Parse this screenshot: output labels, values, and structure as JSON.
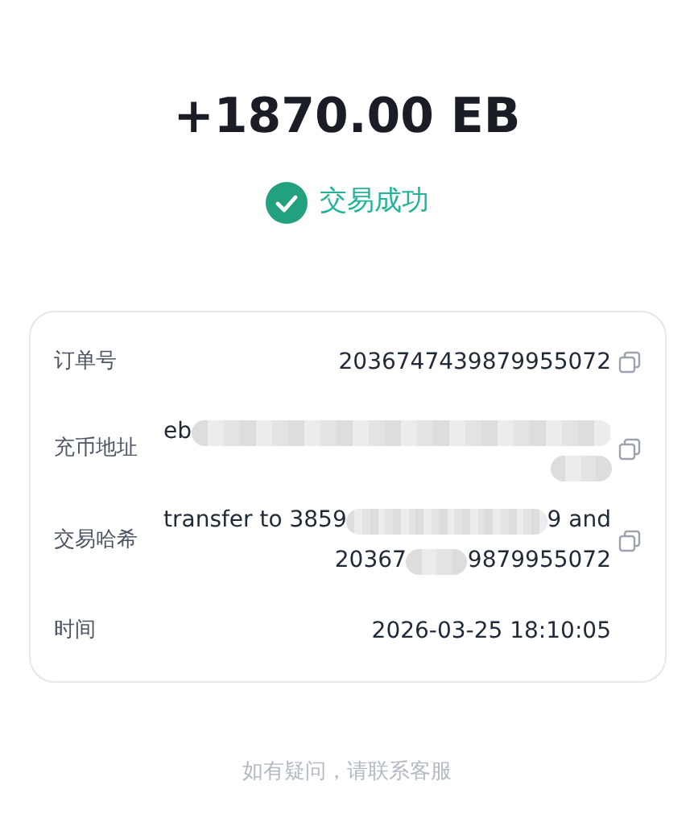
{
  "amount": "+1870.00 EB",
  "status": {
    "text": "交易成功",
    "success": true
  },
  "details": [
    {
      "label": "订单号",
      "lines": [
        [
          {
            "kind": "text",
            "text": "2036747439879955072"
          }
        ]
      ],
      "copyable": true
    },
    {
      "label": "充币地址",
      "lines": [
        [
          {
            "kind": "text",
            "text": "eb"
          },
          {
            "kind": "blur"
          }
        ],
        [
          {
            "kind": "blur"
          }
        ]
      ],
      "copyable": true
    },
    {
      "label": "交易哈希",
      "lines": [
        [
          {
            "kind": "text",
            "text": "transfer to 3859"
          },
          {
            "kind": "blur"
          },
          {
            "kind": "text",
            "text": "9 and"
          }
        ],
        [
          {
            "kind": "text",
            "text": "20367"
          },
          {
            "kind": "blur"
          },
          {
            "kind": "text",
            "text": "9879955072"
          }
        ]
      ],
      "copyable": true
    },
    {
      "label": "时间",
      "lines": [
        [
          {
            "kind": "text",
            "text": "2026-03-25 18:10:05"
          }
        ]
      ],
      "copyable": false
    }
  ],
  "footer": "如有疑问，请联系客服"
}
